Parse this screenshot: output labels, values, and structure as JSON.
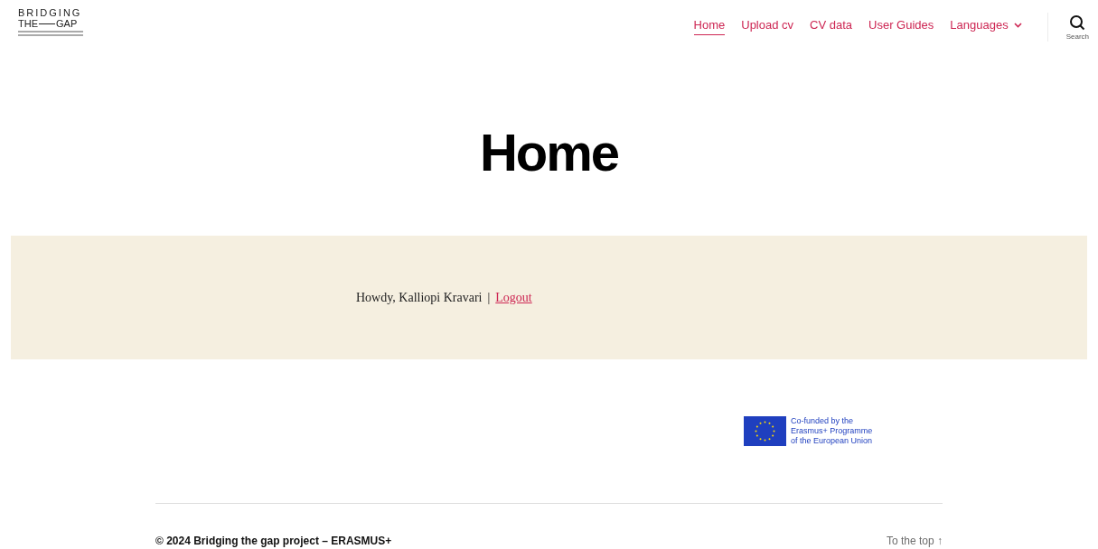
{
  "logo": {
    "line_1": "BRIDGING",
    "line_2a": "THE",
    "line_2b": "GAP"
  },
  "nav": [
    {
      "label": "Home",
      "selected": true,
      "has_caret": false
    },
    {
      "label": "Upload cv",
      "selected": false,
      "has_caret": false
    },
    {
      "label": "CV data",
      "selected": false,
      "has_caret": false
    },
    {
      "label": "User Guides",
      "selected": false,
      "has_caret": false
    },
    {
      "label": "Languages",
      "selected": false,
      "has_caret": true
    }
  ],
  "search": {
    "label": "Search"
  },
  "page_title": "Home",
  "greeting": {
    "text": "Howdy, Kalliopi Kravari",
    "separator": "|",
    "link": "Logout"
  },
  "eu_badge": {
    "lines": [
      "Co-funded by the",
      "Erasmus+ Programme",
      "of the European Union"
    ]
  },
  "footer": {
    "copyright": "© 2024 Bridging the gap project – ERASMUS+",
    "to_top": "To the top ↑"
  }
}
